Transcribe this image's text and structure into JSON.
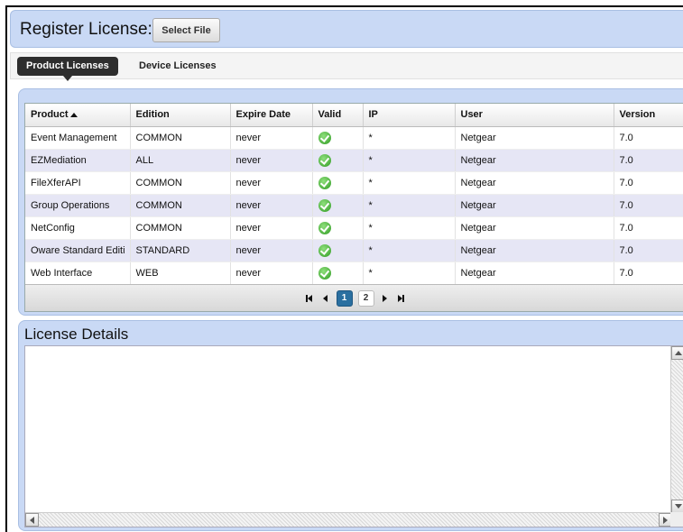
{
  "register": {
    "title": "Register License:",
    "select_file_label": "Select File"
  },
  "tabs": [
    {
      "label": "Product Licenses",
      "active": true
    },
    {
      "label": "Device Licenses",
      "active": false
    }
  ],
  "grid": {
    "columns": [
      "Product",
      "Edition",
      "Expire Date",
      "Valid",
      "IP",
      "User",
      "Version"
    ],
    "sorted_column": "Product",
    "rows": [
      {
        "product": "Event Management",
        "edition": "COMMON",
        "expire": "never",
        "valid": "check-icon",
        "ip": "*",
        "user": "Netgear",
        "version": "7.0"
      },
      {
        "product": "EZMediation",
        "edition": "ALL",
        "expire": "never",
        "valid": "check-icon",
        "ip": "*",
        "user": "Netgear",
        "version": "7.0"
      },
      {
        "product": "FileXferAPI",
        "edition": "COMMON",
        "expire": "never",
        "valid": "check-icon",
        "ip": "*",
        "user": "Netgear",
        "version": "7.0"
      },
      {
        "product": "Group Operations",
        "edition": "COMMON",
        "expire": "never",
        "valid": "check-icon",
        "ip": "*",
        "user": "Netgear",
        "version": "7.0"
      },
      {
        "product": "NetConfig",
        "edition": "COMMON",
        "expire": "never",
        "valid": "check-icon",
        "ip": "*",
        "user": "Netgear",
        "version": "7.0"
      },
      {
        "product": "Oware Standard Editi",
        "edition": "STANDARD",
        "expire": "never",
        "valid": "check-icon",
        "ip": "*",
        "user": "Netgear",
        "version": "7.0"
      },
      {
        "product": "Web Interface",
        "edition": "WEB",
        "expire": "never",
        "valid": "check-icon",
        "ip": "*",
        "user": "Netgear",
        "version": "7.0"
      }
    ]
  },
  "pager": {
    "pages": [
      "1",
      "2"
    ],
    "current": "1"
  },
  "details": {
    "title": "License Details"
  },
  "colors": {
    "panel_bg": "#c9d9f5",
    "alt_row": "#e6e6f5",
    "active_tab": "#2e2e2e",
    "active_page": "#2a6fa0"
  }
}
